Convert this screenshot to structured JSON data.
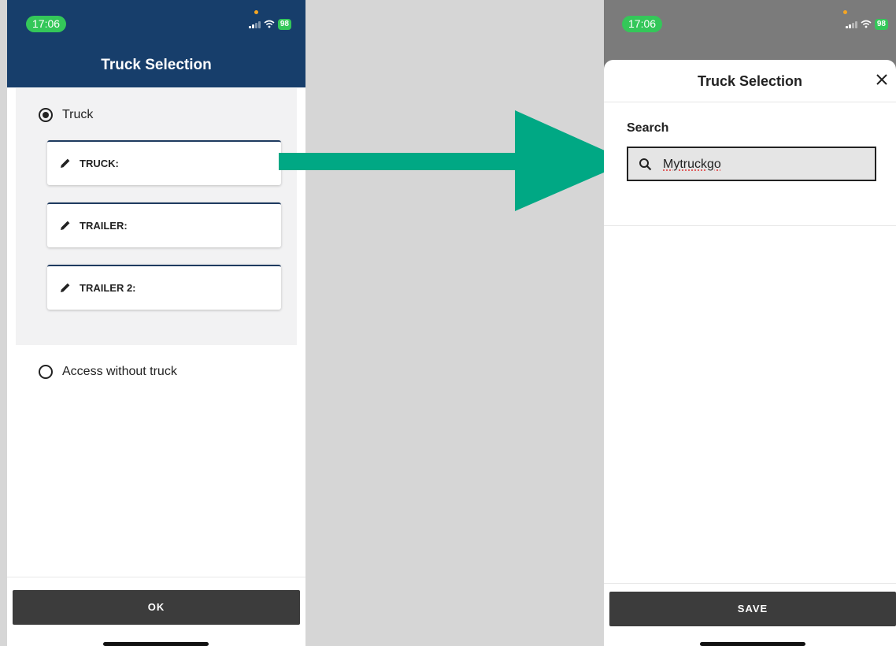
{
  "left_screen": {
    "status": {
      "time": "17:06",
      "battery": "98"
    },
    "title": "Truck Selection",
    "options": {
      "truck": {
        "label": "Truck",
        "selected": true
      },
      "no_truck": {
        "label": "Access without truck",
        "selected": false
      }
    },
    "fields": [
      "TRUCK:",
      "TRAILER:",
      "TRAILER 2:"
    ],
    "ok_label": "OK"
  },
  "right_screen": {
    "status": {
      "time": "17:06",
      "battery": "98"
    },
    "title": "Truck Selection",
    "search_label": "Search",
    "search_value": "Mytruckgo",
    "save_label": "SAVE"
  },
  "colors": {
    "header_blue": "#173e6b",
    "arrow_green": "#00a884",
    "button_dark": "#3c3c3c",
    "status_green": "#34c759"
  },
  "icons": [
    "pencil-icon",
    "search-icon",
    "close-icon",
    "wifi-icon",
    "signal-icon",
    "battery-icon",
    "radio-icon"
  ]
}
